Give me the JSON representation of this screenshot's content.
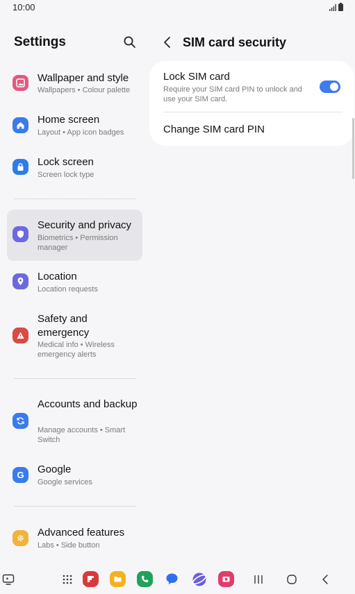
{
  "status_bar": {
    "time": "10:00"
  },
  "left_panel": {
    "title": "Settings",
    "items": [
      {
        "key": "wallpaper",
        "title": "Wallpaper and style",
        "subtitle": "Wallpapers • Colour palette",
        "icon": "wallpaper-icon",
        "color": "#e05a80"
      },
      {
        "key": "home-screen",
        "title": "Home screen",
        "subtitle": "Layout • App icon badges",
        "icon": "home-icon",
        "color": "#3a7bed"
      },
      {
        "key": "lock-screen",
        "title": "Lock screen",
        "subtitle": "Screen lock type",
        "icon": "lock-icon",
        "color": "#2d7de8"
      },
      {
        "key": "security",
        "title": "Security and privacy",
        "subtitle": "Biometrics • Permission manager",
        "icon": "shield-icon",
        "color": "#6c69e0",
        "active": true
      },
      {
        "key": "location",
        "title": "Location",
        "subtitle": "Location requests",
        "icon": "location-pin-icon",
        "color": "#6c69e0"
      },
      {
        "key": "safety",
        "title": "Safety and emergency",
        "subtitle": "Medical info • Wireless emergency alerts",
        "icon": "emergency-icon",
        "color": "#d94b45"
      },
      {
        "key": "accounts",
        "title": "Accounts and backup",
        "subtitle": "Manage accounts • Smart Switch",
        "icon": "sync-icon",
        "color": "#3a7bed"
      },
      {
        "key": "google",
        "title": "Google",
        "subtitle": "Google services",
        "icon": "google-icon",
        "color": "#3a7bed"
      },
      {
        "key": "advanced",
        "title": "Advanced features",
        "subtitle": "Labs • Side button",
        "icon": "gear-plus-icon",
        "color": "#f0b43a"
      }
    ]
  },
  "right_panel": {
    "title": "SIM card security",
    "lock_sim": {
      "title": "Lock SIM card",
      "subtitle": "Require your SIM card PIN to unlock and use your SIM card.",
      "enabled": true
    },
    "change_pin": {
      "title": "Change SIM card PIN"
    }
  },
  "nav_bar": {
    "apps": [
      {
        "name": "apps-drawer-icon"
      },
      {
        "name": "flipboard-app-icon",
        "color": "#d83a3a"
      },
      {
        "name": "my-files-app-icon",
        "color": "#f2b21d"
      },
      {
        "name": "phone-app-icon",
        "color": "#21a25b"
      },
      {
        "name": "messages-app-icon",
        "color": "#2f6fec"
      },
      {
        "name": "internet-app-icon",
        "color": "#6a5fdb"
      },
      {
        "name": "screen-recorder-app-icon",
        "color": "#e03d6a"
      }
    ]
  },
  "colors": {
    "accent": "#3e7bec",
    "background": "#f6f6f8",
    "card": "#ffffff",
    "active_item": "#e6e6ea"
  }
}
